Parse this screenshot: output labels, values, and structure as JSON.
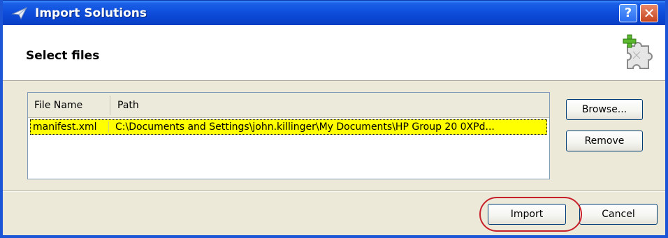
{
  "window": {
    "title": "Import Solutions",
    "help_label": "?",
    "close_label": "✕"
  },
  "header": {
    "title": "Select files"
  },
  "file_list": {
    "columns": [
      "File Name",
      "Path"
    ],
    "rows": [
      {
        "file_name": "manifest.xml",
        "path": "C:\\Documents  and  Settings\\john.killinger\\My  Documents\\HP  Group  20  0XPd..."
      }
    ]
  },
  "buttons": {
    "browse": "Browse...",
    "remove": "Remove",
    "import": "Import",
    "cancel": "Cancel"
  },
  "colors": {
    "titlebar": "#0a45d0",
    "selection": "#ffff00",
    "annotation": "#c8202a"
  }
}
